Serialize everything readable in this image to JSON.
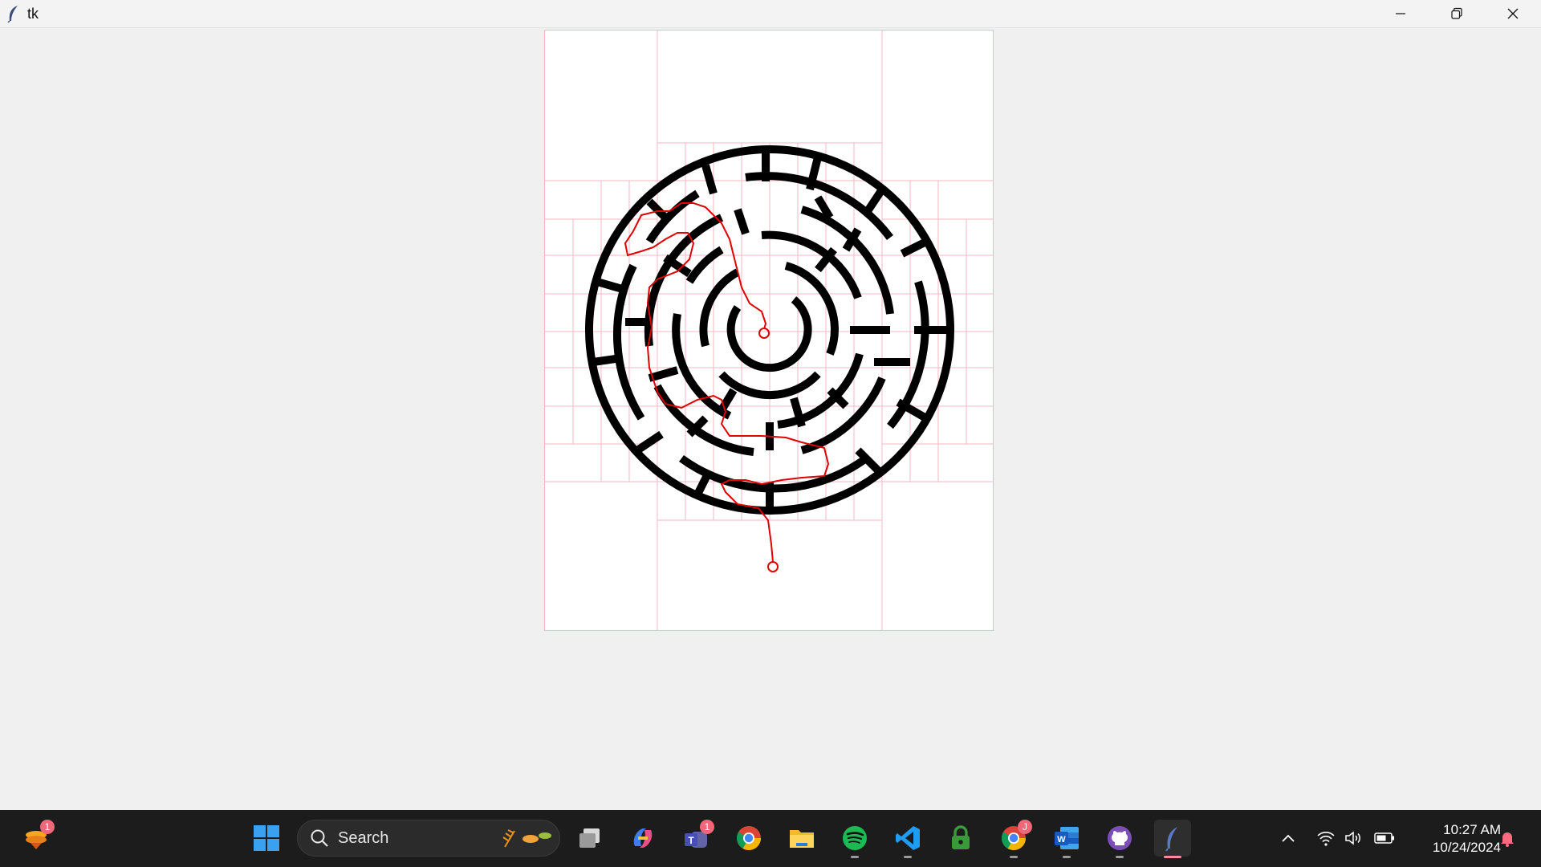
{
  "window": {
    "title": "tk",
    "controls": [
      "minimize-icon",
      "restore-icon",
      "close-icon"
    ]
  },
  "canvas": {
    "content": "circular maze with red solution path",
    "colors": {
      "wall": "#000000",
      "path": "#e00000",
      "grid": "#f3b9c3",
      "background": "#ffffff"
    }
  },
  "taskbar": {
    "widgets_badge": "1",
    "search_placeholder": "Search",
    "apps": [
      {
        "name": "start-icon"
      },
      {
        "name": "task-view-icon"
      },
      {
        "name": "copilot-icon"
      },
      {
        "name": "teams-icon",
        "badge": "1"
      },
      {
        "name": "chrome-icon"
      },
      {
        "name": "file-explorer-icon"
      },
      {
        "name": "spotify-icon"
      },
      {
        "name": "vscode-icon"
      },
      {
        "name": "vpn-lock-icon"
      },
      {
        "name": "chrome-profile-icon",
        "badge": "J"
      },
      {
        "name": "word-icon"
      },
      {
        "name": "github-desktop-icon"
      },
      {
        "name": "tk-feather-icon"
      }
    ],
    "clock": {
      "time": "10:27 AM",
      "date": "10/24/2024"
    }
  }
}
